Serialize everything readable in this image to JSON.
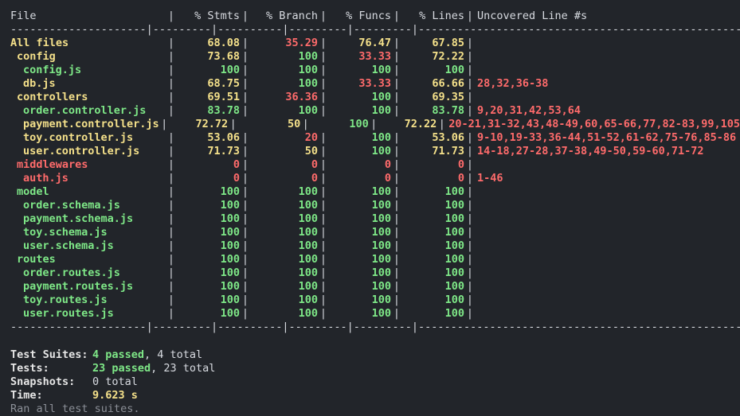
{
  "colors": {
    "background": "#22252a",
    "green": "#7ee787",
    "red": "#ff6b6b",
    "yellow": "#f4e08a",
    "text": "#d7dae0",
    "dim": "#8b8f97"
  },
  "table": {
    "headers": {
      "file": "File",
      "stmts": "% Stmts",
      "branch": "% Branch",
      "funcs": "% Funcs",
      "lines": "% Lines",
      "uncovered": "Uncovered Line #s"
    },
    "separator": "---------------------|---------|----------|---------|---------|--------------------------------------------------",
    "rows": [
      {
        "name": "All files",
        "indent": 0,
        "stmts": "68.08",
        "branch": "35.29",
        "funcs": "76.47",
        "lines": "67.85",
        "uncovered": "",
        "colors": [
          "yellow",
          "yellow",
          "red",
          "yellow",
          "yellow",
          "red"
        ]
      },
      {
        "name": "config",
        "indent": 1,
        "stmts": "73.68",
        "branch": "100",
        "funcs": "33.33",
        "lines": "72.22",
        "uncovered": "",
        "colors": [
          "yellow",
          "yellow",
          "green",
          "red",
          "yellow",
          "red"
        ]
      },
      {
        "name": "config.js",
        "indent": 2,
        "stmts": "100",
        "branch": "100",
        "funcs": "100",
        "lines": "100",
        "uncovered": "",
        "colors": [
          "green",
          "green",
          "green",
          "green",
          "green",
          "green"
        ]
      },
      {
        "name": "db.js",
        "indent": 2,
        "stmts": "68.75",
        "branch": "100",
        "funcs": "33.33",
        "lines": "66.66",
        "uncovered": "28,32,36-38",
        "colors": [
          "yellow",
          "yellow",
          "green",
          "red",
          "yellow",
          "red"
        ]
      },
      {
        "name": "controllers",
        "indent": 1,
        "stmts": "69.51",
        "branch": "36.36",
        "funcs": "100",
        "lines": "69.35",
        "uncovered": "",
        "colors": [
          "yellow",
          "yellow",
          "red",
          "green",
          "yellow",
          "red"
        ]
      },
      {
        "name": "order.controller.js",
        "indent": 2,
        "stmts": "83.78",
        "branch": "100",
        "funcs": "100",
        "lines": "83.78",
        "uncovered": "9,20,31,42,53,64",
        "colors": [
          "green",
          "green",
          "green",
          "green",
          "green",
          "red"
        ]
      },
      {
        "name": "payment.controller.js",
        "indent": 2,
        "stmts": "72.72",
        "branch": "50",
        "funcs": "100",
        "lines": "72.22",
        "uncovered": "20-21,31-32,43,48-49,60,65-66,77,82-83,99,105",
        "colors": [
          "yellow",
          "yellow",
          "yellow",
          "green",
          "yellow",
          "red"
        ]
      },
      {
        "name": "toy.controller.js",
        "indent": 2,
        "stmts": "53.06",
        "branch": "20",
        "funcs": "100",
        "lines": "53.06",
        "uncovered": "9-10,19-33,36-44,51-52,61-62,75-76,85-86",
        "colors": [
          "yellow",
          "yellow",
          "red",
          "green",
          "yellow",
          "red"
        ]
      },
      {
        "name": "user.controller.js",
        "indent": 2,
        "stmts": "71.73",
        "branch": "50",
        "funcs": "100",
        "lines": "71.73",
        "uncovered": "14-18,27-28,37-38,49-50,59-60,71-72",
        "colors": [
          "yellow",
          "yellow",
          "yellow",
          "green",
          "yellow",
          "red"
        ]
      },
      {
        "name": "middlewares",
        "indent": 1,
        "stmts": "0",
        "branch": "0",
        "funcs": "0",
        "lines": "0",
        "uncovered": "",
        "colors": [
          "red",
          "red",
          "red",
          "red",
          "red",
          "red"
        ]
      },
      {
        "name": "auth.js",
        "indent": 2,
        "stmts": "0",
        "branch": "0",
        "funcs": "0",
        "lines": "0",
        "uncovered": "1-46",
        "colors": [
          "red",
          "red",
          "red",
          "red",
          "red",
          "red"
        ]
      },
      {
        "name": "model",
        "indent": 1,
        "stmts": "100",
        "branch": "100",
        "funcs": "100",
        "lines": "100",
        "uncovered": "",
        "colors": [
          "green",
          "green",
          "green",
          "green",
          "green",
          "green"
        ]
      },
      {
        "name": "order.schema.js",
        "indent": 2,
        "stmts": "100",
        "branch": "100",
        "funcs": "100",
        "lines": "100",
        "uncovered": "",
        "colors": [
          "green",
          "green",
          "green",
          "green",
          "green",
          "green"
        ]
      },
      {
        "name": "payment.schema.js",
        "indent": 2,
        "stmts": "100",
        "branch": "100",
        "funcs": "100",
        "lines": "100",
        "uncovered": "",
        "colors": [
          "green",
          "green",
          "green",
          "green",
          "green",
          "green"
        ]
      },
      {
        "name": "toy.schema.js",
        "indent": 2,
        "stmts": "100",
        "branch": "100",
        "funcs": "100",
        "lines": "100",
        "uncovered": "",
        "colors": [
          "green",
          "green",
          "green",
          "green",
          "green",
          "green"
        ]
      },
      {
        "name": "user.schema.js",
        "indent": 2,
        "stmts": "100",
        "branch": "100",
        "funcs": "100",
        "lines": "100",
        "uncovered": "",
        "colors": [
          "green",
          "green",
          "green",
          "green",
          "green",
          "green"
        ]
      },
      {
        "name": "routes",
        "indent": 1,
        "stmts": "100",
        "branch": "100",
        "funcs": "100",
        "lines": "100",
        "uncovered": "",
        "colors": [
          "green",
          "green",
          "green",
          "green",
          "green",
          "green"
        ]
      },
      {
        "name": "order.routes.js",
        "indent": 2,
        "stmts": "100",
        "branch": "100",
        "funcs": "100",
        "lines": "100",
        "uncovered": "",
        "colors": [
          "green",
          "green",
          "green",
          "green",
          "green",
          "green"
        ]
      },
      {
        "name": "payment.routes.js",
        "indent": 2,
        "stmts": "100",
        "branch": "100",
        "funcs": "100",
        "lines": "100",
        "uncovered": "",
        "colors": [
          "green",
          "green",
          "green",
          "green",
          "green",
          "green"
        ]
      },
      {
        "name": "toy.routes.js",
        "indent": 2,
        "stmts": "100",
        "branch": "100",
        "funcs": "100",
        "lines": "100",
        "uncovered": "",
        "colors": [
          "green",
          "green",
          "green",
          "green",
          "green",
          "green"
        ]
      },
      {
        "name": "user.routes.js",
        "indent": 2,
        "stmts": "100",
        "branch": "100",
        "funcs": "100",
        "lines": "100",
        "uncovered": "",
        "colors": [
          "green",
          "green",
          "green",
          "green",
          "green",
          "green"
        ]
      }
    ]
  },
  "summary": {
    "suites": {
      "label": "Test Suites:",
      "passed": "4 passed",
      "rest": ", 4 total"
    },
    "tests": {
      "label": "Tests:",
      "passed": "23 passed",
      "rest": ", 23 total"
    },
    "snapshots": {
      "label": "Snapshots:",
      "value": "0 total"
    },
    "time": {
      "label": "Time:",
      "value": "9.623 s"
    },
    "footer": "Ran all test suites."
  }
}
